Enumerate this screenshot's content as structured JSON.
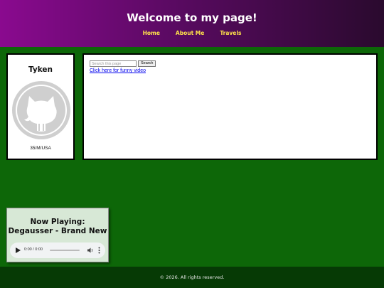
{
  "header": {
    "title": "Welcome to my page!",
    "nav": [
      "Home",
      "About Me",
      "Travels"
    ]
  },
  "profile": {
    "name": "Tyken",
    "avatar_icon": "github-octocat-icon",
    "info": "35/M/USA"
  },
  "main": {
    "search": {
      "placeholder": "Search this page",
      "button_label": "Search"
    },
    "video_link": "Click here for funny video"
  },
  "player": {
    "title_line1": "Now Playing:",
    "title_line2": "Degausser - Brand New",
    "time": "0:00 / 0:00"
  },
  "footer": {
    "text": "© 2026. All rights reserved."
  },
  "colors": {
    "page_background": "#0d6708",
    "nav_link": "#ffe34a",
    "footer_background": "#063a05",
    "player_background": "#d7e8d6"
  }
}
